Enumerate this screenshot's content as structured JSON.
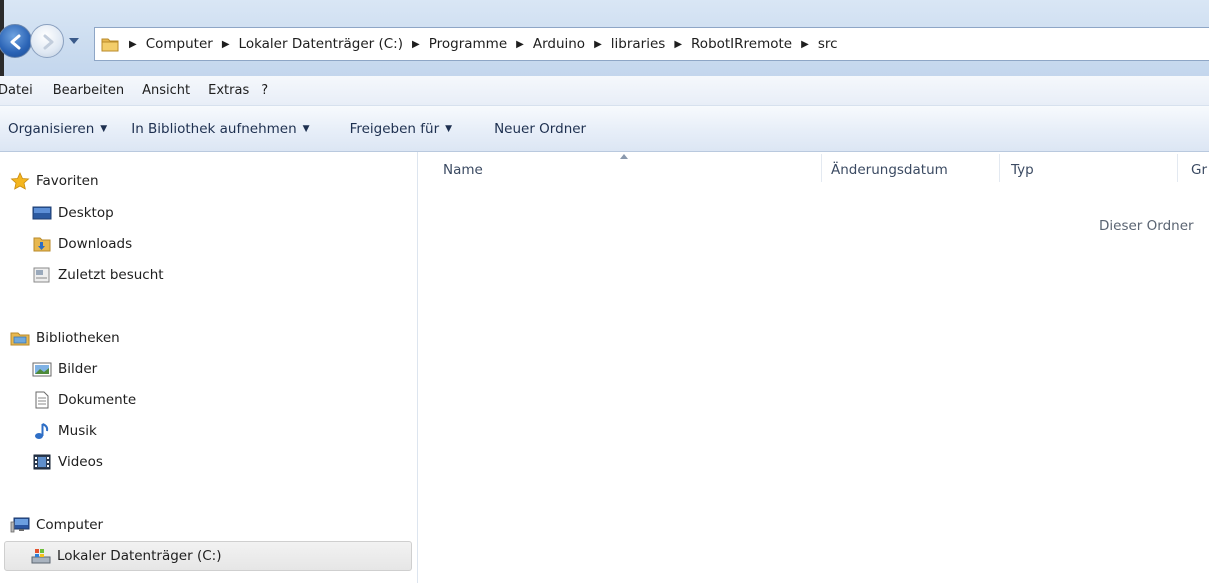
{
  "address_bar": {
    "breadcrumbs": [
      "Computer",
      "Lokaler Datenträger (C:)",
      "Programme",
      "Arduino",
      "libraries",
      "RobotIRremote",
      "src"
    ]
  },
  "menu": {
    "items": [
      "Datei",
      "Bearbeiten",
      "Ansicht",
      "Extras",
      "?"
    ]
  },
  "commands": {
    "organize": "Organisieren",
    "include_library": "In Bibliothek aufnehmen",
    "share_with": "Freigeben für",
    "new_folder": "Neuer Ordner"
  },
  "nav_pane": {
    "favorites": {
      "label": "Favoriten",
      "items": [
        "Desktop",
        "Downloads",
        "Zuletzt besucht"
      ]
    },
    "libraries": {
      "label": "Bibliotheken",
      "items": [
        "Bilder",
        "Dokumente",
        "Musik",
        "Videos"
      ]
    },
    "computer": {
      "label": "Computer",
      "items": [
        "Lokaler Datenträger (C:)"
      ]
    }
  },
  "content": {
    "columns": [
      "Name",
      "Änderungsdatum",
      "Typ",
      "Gr"
    ],
    "empty_message": "Dieser Ordner"
  },
  "colors": {
    "chrome_blue": "#cfdff1",
    "command_text": "#1e3050",
    "selection_gray": "#e6e6e6"
  }
}
